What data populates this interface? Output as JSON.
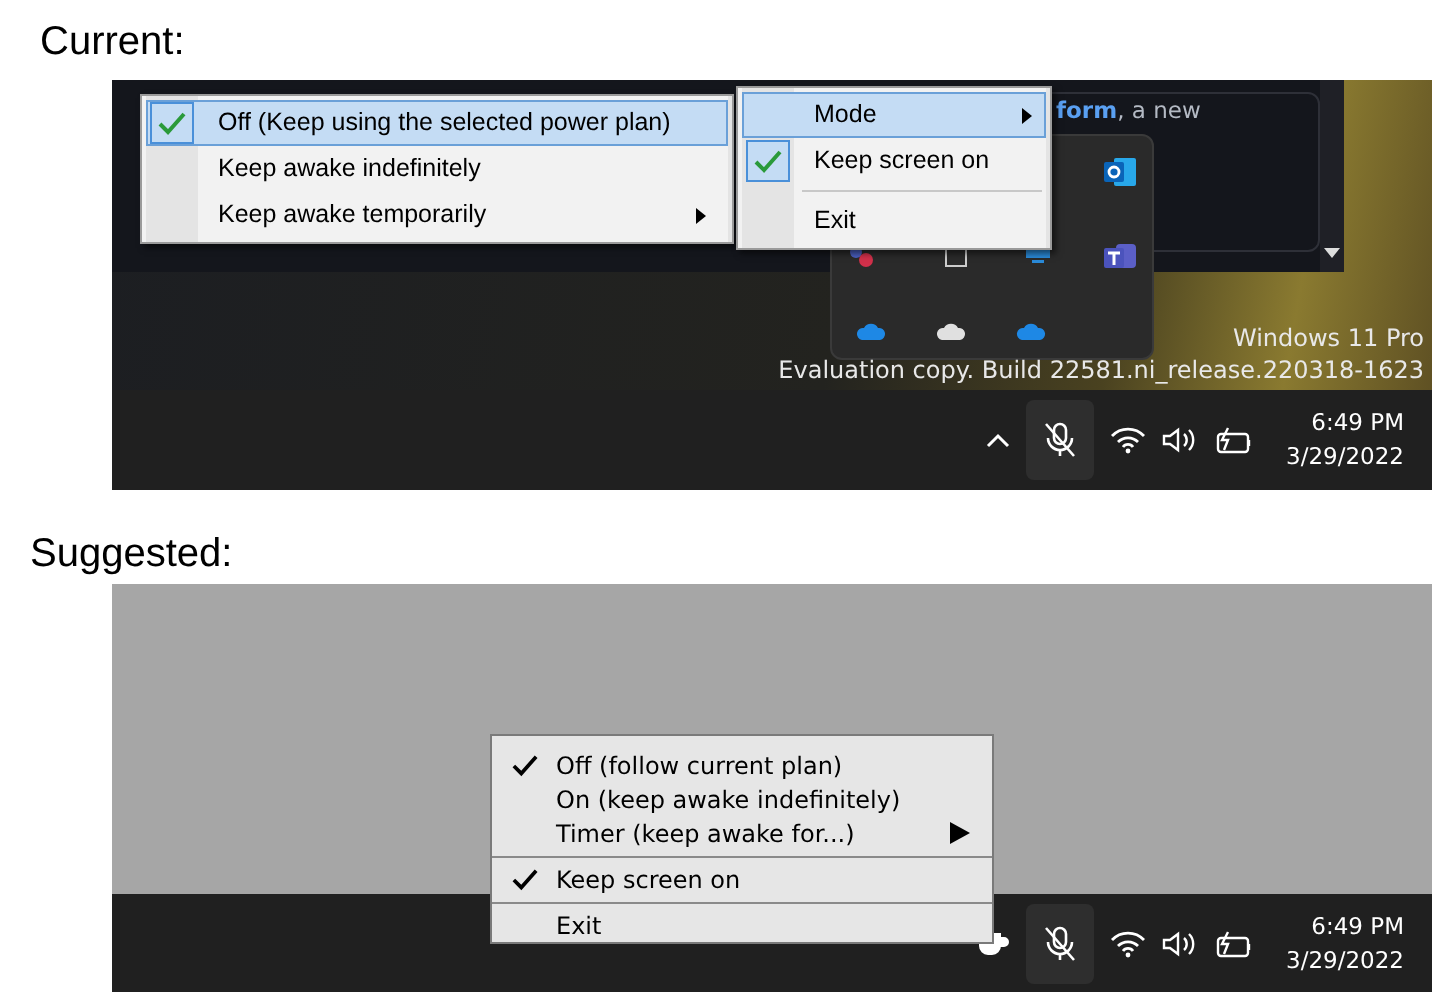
{
  "current": {
    "label": "Current:",
    "background_text": {
      "link": "form",
      "text": ", a new"
    },
    "mode_menu": [
      {
        "label": "Off (Keep using the selected power plan)",
        "checked": true,
        "selected": true,
        "submenu": false
      },
      {
        "label": "Keep awake indefinitely",
        "checked": false,
        "selected": false,
        "submenu": false
      },
      {
        "label": "Keep awake temporarily",
        "checked": false,
        "selected": false,
        "submenu": true
      }
    ],
    "main_menu": [
      {
        "kind": "item",
        "label": "Mode",
        "checked": false,
        "selected": true,
        "submenu": true
      },
      {
        "kind": "item",
        "label": "Keep screen on",
        "checked": true,
        "selected": false,
        "submenu": false
      },
      {
        "kind": "separator"
      },
      {
        "kind": "item",
        "label": "Exit",
        "checked": false,
        "selected": false,
        "submenu": false
      }
    ],
    "watermark": [
      "Windows 11 Pro",
      "Evaluation copy. Build 22581.ni_release.220318-1623"
    ],
    "taskbar": {
      "time": "6:49 PM",
      "date": "3/29/2022"
    }
  },
  "suggested": {
    "label": "Suggested:",
    "menu": [
      {
        "kind": "item",
        "label": "Off (follow current plan)",
        "checked": true,
        "selected": false,
        "submenu": false
      },
      {
        "kind": "item",
        "label": "On (keep awake indefinitely)",
        "checked": false,
        "selected": false,
        "submenu": false
      },
      {
        "kind": "item",
        "label": "Timer (keep awake for...)",
        "checked": false,
        "selected": false,
        "submenu": true
      },
      {
        "kind": "separator"
      },
      {
        "kind": "item",
        "label": "Keep screen on",
        "checked": true,
        "selected": false,
        "submenu": false
      },
      {
        "kind": "separator"
      },
      {
        "kind": "item",
        "label": "Exit",
        "checked": false,
        "selected": false,
        "submenu": false
      }
    ],
    "taskbar": {
      "time": "6:49 PM",
      "date": "3/29/2022"
    }
  }
}
